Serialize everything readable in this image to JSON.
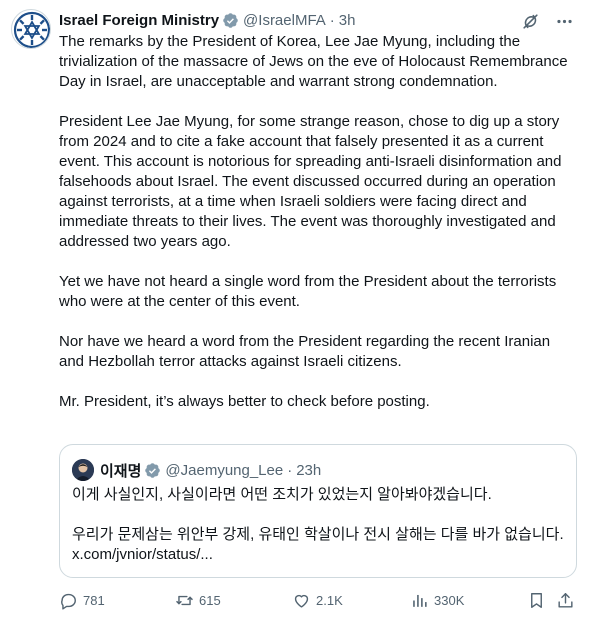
{
  "tweet": {
    "author_name": "Israel Foreign Ministry",
    "handle": "@IsraelMFA",
    "separator": "·",
    "time": "3h",
    "paragraphs": [
      "The remarks by the President of Korea, Lee Jae Myung, including the trivialization of the massacre of Jews on the eve of Holocaust Remembrance Day in Israel, are unacceptable and warrant strong condemnation.",
      "President Lee Jae Myung, for some strange reason, chose to dig up a story from 2024 and to cite a fake account that falsely presented it as a current event. This account is notorious for spreading anti-Israeli disinformation and falsehoods about Israel. The event discussed occurred during an operation against terrorists, at a time when Israeli soldiers were facing direct and immediate threats to their lives. The event was thoroughly investigated and addressed two years ago.",
      "Yet we have not heard a single word from the President about the terrorists who were at the center of this event.",
      "Nor have we heard a word from the President regarding the recent Iranian and Hezbollah terror attacks against Israeli citizens.",
      "Mr. President, it’s always better to check before posting."
    ]
  },
  "quote": {
    "author_name": "이재명",
    "handle": "@Jaemyung_Lee",
    "separator": "·",
    "time": "23h",
    "paragraphs": [
      "이게 사실인지, 사실이라면 어떤 조치가 있었는지 알아봐야겠습니다.",
      "우리가 문제삼는 위안부 강제, 유태인 학살이나 전시 살해는 다를 바가 없습니다. x.com/jvnior/status/..."
    ]
  },
  "metrics": {
    "replies": "781",
    "reposts": "615",
    "likes": "2.1K",
    "views": "330K"
  },
  "icons": {
    "verified": "verified-badge-icon",
    "grok": "grok-icon",
    "more": "more-icon",
    "reply": "reply-icon",
    "repost": "repost-icon",
    "like": "like-icon",
    "views": "views-icon",
    "bookmark": "bookmark-icon",
    "share": "share-icon"
  },
  "colors": {
    "text": "#0f1419",
    "secondary": "#536471",
    "border": "#cfd9de",
    "verified_badge": "#829aab",
    "logo": "#1d4e89"
  }
}
